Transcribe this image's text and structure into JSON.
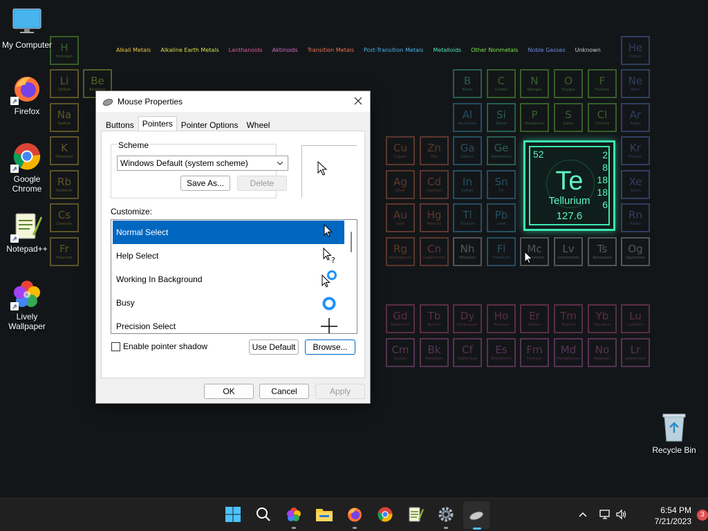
{
  "desktop": {
    "icons": [
      {
        "label": "My Computer",
        "icon": "monitor-icon",
        "shortcut": false
      },
      {
        "label": "Firefox",
        "icon": "firefox-icon",
        "shortcut": true
      },
      {
        "label": "Google Chrome",
        "icon": "chrome-icon",
        "shortcut": true
      },
      {
        "label": "Notepad++",
        "icon": "notepadpp-icon",
        "shortcut": true
      },
      {
        "label": "Lively Wallpaper",
        "icon": "lively-icon",
        "shortcut": true
      },
      {
        "label": "Recycle Bin",
        "icon": "recycle-bin-icon",
        "shortcut": false
      }
    ]
  },
  "wallpaper": {
    "legend": [
      {
        "label": "Alkali Metals",
        "color": "#e8c84a"
      },
      {
        "label": "Alkaline Earth Metals",
        "color": "#d6e04a"
      },
      {
        "label": "Lanthanoids",
        "color": "#e05aa0"
      },
      {
        "label": "Aktinoids",
        "color": "#d66acb"
      },
      {
        "label": "Transition Metals",
        "color": "#e8745a"
      },
      {
        "label": "Post-Transition Metals",
        "color": "#4ab4e8"
      },
      {
        "label": "Metalloids",
        "color": "#4ae8b4"
      },
      {
        "label": "Other Nonmetals",
        "color": "#7ae84a"
      },
      {
        "label": "Noble Gasses",
        "color": "#6a8ae8"
      },
      {
        "label": "Unknown",
        "color": "#cccccc"
      }
    ],
    "elements": [
      {
        "sym": "H",
        "name": "Hydrogen",
        "color": "#7ae84a"
      },
      {
        "sym": "He",
        "name": "Helium",
        "color": "#6a8ae8"
      },
      {
        "sym": "Li",
        "name": "Lithium",
        "color": "#e8c84a"
      },
      {
        "sym": "Be",
        "name": "Beryllium",
        "color": "#d6e04a"
      },
      {
        "sym": "B",
        "name": "Boron",
        "color": "#4ae8b4"
      },
      {
        "sym": "C",
        "name": "Carbon",
        "color": "#7ae84a"
      },
      {
        "sym": "N",
        "name": "Nitrogen",
        "color": "#7ae84a"
      },
      {
        "sym": "O",
        "name": "Oxygen",
        "color": "#7ae84a"
      },
      {
        "sym": "F",
        "name": "Fluorine",
        "color": "#7ae84a"
      },
      {
        "sym": "Ne",
        "name": "Neon",
        "color": "#6a8ae8"
      },
      {
        "sym": "Na",
        "name": "Sodium",
        "color": "#e8c84a"
      },
      {
        "sym": "Al",
        "name": "Aluminium",
        "color": "#4ab4e8"
      },
      {
        "sym": "Si",
        "name": "Silicon",
        "color": "#4ae8b4"
      },
      {
        "sym": "P",
        "name": "Phosphorus",
        "color": "#7ae84a"
      },
      {
        "sym": "S",
        "name": "Sulfur",
        "color": "#7ae84a"
      },
      {
        "sym": "Cl",
        "name": "Chlorine",
        "color": "#7ae84a"
      },
      {
        "sym": "Ar",
        "name": "Argon",
        "color": "#6a8ae8"
      },
      {
        "sym": "K",
        "name": "Potassium",
        "color": "#e8c84a"
      },
      {
        "sym": "Cu",
        "name": "Copper",
        "color": "#e8745a"
      },
      {
        "sym": "Zn",
        "name": "Zinc",
        "color": "#e8745a"
      },
      {
        "sym": "Ga",
        "name": "Gallium",
        "color": "#4ab4e8"
      },
      {
        "sym": "Ge",
        "name": "Germanium",
        "color": "#4ae8b4"
      },
      {
        "sym": "Kr",
        "name": "Krypton",
        "color": "#6a8ae8"
      },
      {
        "sym": "Rb",
        "name": "Rubidium",
        "color": "#e8c84a"
      },
      {
        "sym": "Ag",
        "name": "Silver",
        "color": "#e8745a"
      },
      {
        "sym": "Cd",
        "name": "Cadmium",
        "color": "#e8745a"
      },
      {
        "sym": "In",
        "name": "Indium",
        "color": "#4ab4e8"
      },
      {
        "sym": "Sn",
        "name": "Tin",
        "color": "#4ab4e8"
      },
      {
        "sym": "Xe",
        "name": "Xenon",
        "color": "#6a8ae8"
      },
      {
        "sym": "Cs",
        "name": "Caesium",
        "color": "#e8c84a"
      },
      {
        "sym": "Au",
        "name": "Gold",
        "color": "#e8745a"
      },
      {
        "sym": "Hg",
        "name": "Mercury",
        "color": "#e8745a"
      },
      {
        "sym": "Tl",
        "name": "Thallium",
        "color": "#4ab4e8"
      },
      {
        "sym": "Pb",
        "name": "Lead",
        "color": "#4ab4e8"
      },
      {
        "sym": "Rn",
        "name": "Radon",
        "color": "#6a8ae8"
      },
      {
        "sym": "Fr",
        "name": "Francium",
        "color": "#e8c84a"
      },
      {
        "sym": "Rg",
        "name": "Roentgenium",
        "color": "#e8745a"
      },
      {
        "sym": "Cn",
        "name": "Copernicium",
        "color": "#e8745a"
      },
      {
        "sym": "Nh",
        "name": "Nihonium",
        "color": "#cccccc"
      },
      {
        "sym": "Fl",
        "name": "Flerovium",
        "color": "#4ab4e8"
      },
      {
        "sym": "Mc",
        "name": "Moscovium",
        "color": "#cccccc"
      },
      {
        "sym": "Lv",
        "name": "Livermorium",
        "color": "#cccccc"
      },
      {
        "sym": "Ts",
        "name": "Tennessine",
        "color": "#cccccc"
      },
      {
        "sym": "Og",
        "name": "Oganesson",
        "color": "#cccccc"
      },
      {
        "sym": "Gd",
        "name": "Gadolinium",
        "color": "#e05aa0"
      },
      {
        "sym": "Tb",
        "name": "Terbium",
        "color": "#e05aa0"
      },
      {
        "sym": "Dy",
        "name": "Dysprosium",
        "color": "#e05aa0"
      },
      {
        "sym": "Ho",
        "name": "Holmium",
        "color": "#e05aa0"
      },
      {
        "sym": "Er",
        "name": "Erbium",
        "color": "#e05aa0"
      },
      {
        "sym": "Tm",
        "name": "Thulium",
        "color": "#e05aa0"
      },
      {
        "sym": "Yb",
        "name": "Ytterbium",
        "color": "#e05aa0"
      },
      {
        "sym": "Lu",
        "name": "Lutetium",
        "color": "#e05aa0"
      },
      {
        "sym": "Cm",
        "name": "Curium",
        "color": "#d66acb"
      },
      {
        "sym": "Bk",
        "name": "Berkelium",
        "color": "#d66acb"
      },
      {
        "sym": "Cf",
        "name": "Californium",
        "color": "#d66acb"
      },
      {
        "sym": "Es",
        "name": "Einsteinium",
        "color": "#d66acb"
      },
      {
        "sym": "Fm",
        "name": "Fermium",
        "color": "#d66acb"
      },
      {
        "sym": "Md",
        "name": "Mendelevium",
        "color": "#d66acb"
      },
      {
        "sym": "No",
        "name": "Nobelium",
        "color": "#d66acb"
      },
      {
        "sym": "Lr",
        "name": "Lawrencium",
        "color": "#d66acb"
      }
    ],
    "featured": {
      "number": "52",
      "shells": [
        "2",
        "8",
        "18",
        "18",
        "6"
      ],
      "symbol": "Te",
      "name": "Tellurium",
      "mass": "127.6",
      "color": "#3ce8b0"
    }
  },
  "dialog": {
    "title": "Mouse Properties",
    "tabs": [
      "Buttons",
      "Pointers",
      "Pointer Options",
      "Wheel"
    ],
    "active_tab": "Pointers",
    "scheme": {
      "legend": "Scheme",
      "selected": "Windows Default (system scheme)",
      "save_as": "Save As...",
      "delete": "Delete"
    },
    "customize_label": "Customize:",
    "cursors": [
      {
        "label": "Normal Select",
        "icon": "arrow-cursor-icon",
        "selected": true
      },
      {
        "label": "Help Select",
        "icon": "help-cursor-icon",
        "selected": false
      },
      {
        "label": "Working In Background",
        "icon": "working-cursor-icon",
        "selected": false
      },
      {
        "label": "Busy",
        "icon": "busy-cursor-icon",
        "selected": false
      },
      {
        "label": "Precision Select",
        "icon": "crosshair-cursor-icon",
        "selected": false
      }
    ],
    "enable_shadow": "Enable pointer shadow",
    "shadow_checked": false,
    "use_default": "Use Default",
    "browse": "Browse...",
    "ok": "OK",
    "cancel": "Cancel",
    "apply": "Apply"
  },
  "taskbar": {
    "apps": [
      "start-icon",
      "search-icon",
      "lively-icon",
      "file-explorer-icon",
      "firefox-icon",
      "chrome-icon",
      "notepadpp-icon",
      "settings-icon",
      "mouse-properties-icon"
    ],
    "time": "6:54 PM",
    "date": "7/21/2023",
    "notification_count": "3"
  },
  "accent": "#0067c0"
}
